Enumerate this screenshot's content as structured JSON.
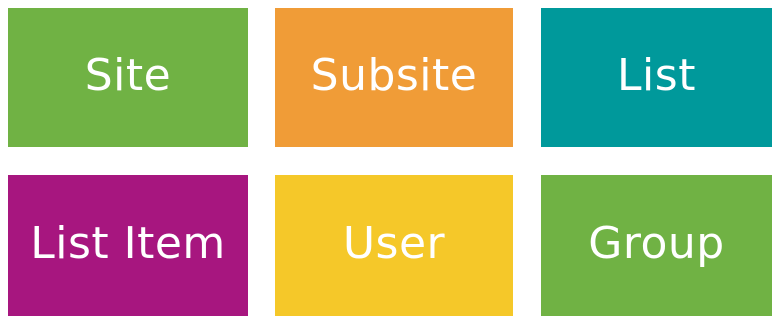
{
  "tiles": [
    {
      "label": "Site",
      "color": "#70b244"
    },
    {
      "label": "Subsite",
      "color": "#f09c37"
    },
    {
      "label": "List",
      "color": "#00999b"
    },
    {
      "label": "List Item",
      "color": "#a7167f"
    },
    {
      "label": "User",
      "color": "#f5c829"
    },
    {
      "label": "Group",
      "color": "#70b244"
    }
  ]
}
